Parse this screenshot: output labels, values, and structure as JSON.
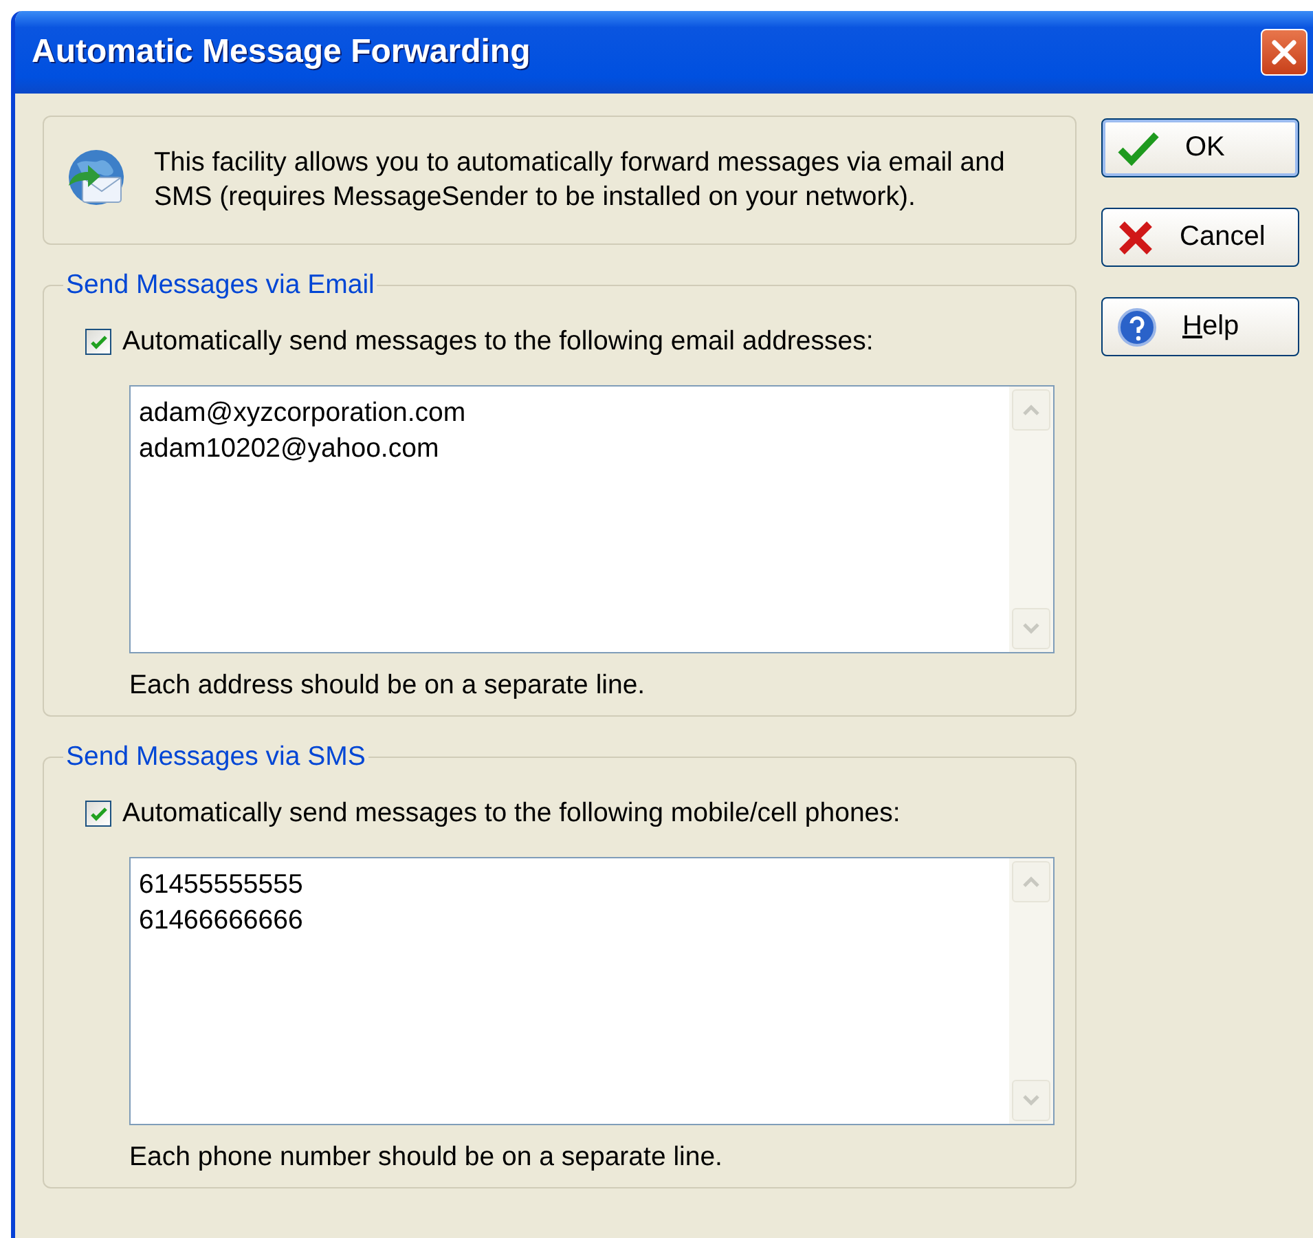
{
  "window": {
    "title": "Automatic Message Forwarding"
  },
  "info": {
    "text": "This facility allows you to automatically forward messages via email and SMS (requires MessageSender to be installed on your network)."
  },
  "groups": [
    {
      "legend": "Send Messages via Email",
      "checkbox": {
        "label": "Automatically send messages to the following email addresses:",
        "checked": true
      },
      "lines": [
        "adam@xyzcorporation.com",
        "adam10202@yahoo.com"
      ],
      "hint": "Each address should be on a separate line."
    },
    {
      "legend": "Send Messages via SMS",
      "checkbox": {
        "label": "Automatically send messages to the following mobile/cell phones:",
        "checked": true
      },
      "lines": [
        "61455555555",
        "61466666666"
      ],
      "hint": "Each phone number should be on a separate line."
    }
  ],
  "buttons": [
    {
      "kind": "ok",
      "label": "OK",
      "focused": true,
      "underline_first": false
    },
    {
      "kind": "cancel",
      "label": "Cancel",
      "focused": false,
      "underline_first": false
    },
    {
      "kind": "help",
      "label": "Help",
      "focused": false,
      "underline_first": true
    }
  ]
}
